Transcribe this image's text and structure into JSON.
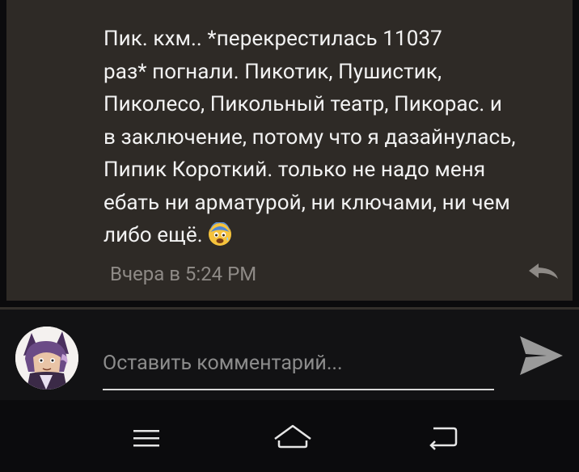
{
  "comment": {
    "text": "Пик. кхм.. *перекрестилась 11037\nраз* погнали. Пикотик, Пушистик,\nПиколесо, Пикольный театр, Пикорас. и\nв заключение, потому что я дазайнулась,\nПипик Короткий. только не надо меня\nебать ни арматурой, ни ключами, ни чем\nлибо ещё.",
    "emoji": "fearful-face-emoji",
    "time": "Вчера в 5:24 PM",
    "reply_icon": "reply-arrow-icon"
  },
  "composer": {
    "placeholder": "Оставить комментарий...",
    "value": "",
    "avatar_icon": "user-avatar-cartoon",
    "send_icon": "send-icon"
  },
  "navbar": {
    "menu_icon": "menu-icon",
    "home_icon": "home-icon",
    "back_icon": "back-icon"
  },
  "colors": {
    "card_bg": "#2e2a26",
    "text": "#f2f2f2",
    "muted": "#8e8a86",
    "screen_bg": "#0b0b0d"
  }
}
